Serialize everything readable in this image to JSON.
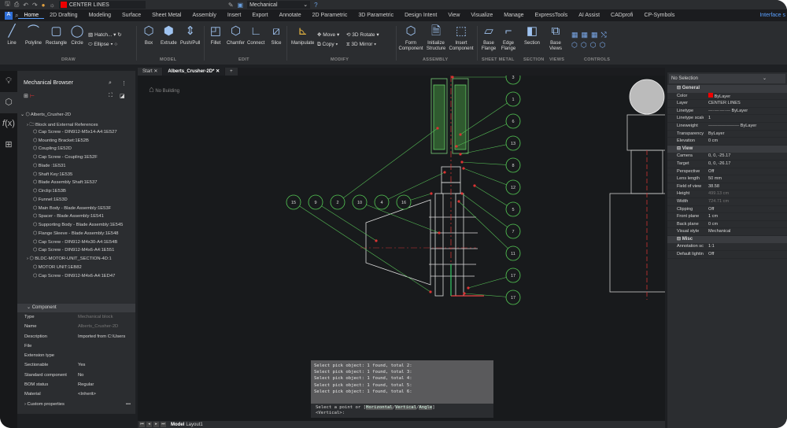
{
  "quick_access": {
    "layer": "CENTER LINES",
    "layer_color": "#e00000",
    "workspace": "Mechanical"
  },
  "menu": {
    "tabs": [
      "Home",
      "2D Drafting",
      "Modeling",
      "Surface",
      "Sheet Metal",
      "Assembly",
      "Insert",
      "Export",
      "Annotate",
      "2D Parametric",
      "3D Parametric",
      "Design Intent",
      "View",
      "Visualize",
      "Manage",
      "ExpressTools",
      "AI Assist",
      "CADprofi",
      "CP-Symbols"
    ],
    "interface": "Interface s"
  },
  "ribbon": {
    "draw": {
      "label": "DRAW",
      "buttons": [
        "Line",
        "Polyline",
        "Rectangle",
        "Circle"
      ],
      "small": [
        "Hatch...",
        "Ellipse"
      ]
    },
    "model": {
      "label": "MODEL",
      "buttons": [
        "Box",
        "Extrude",
        "Push/Pull"
      ]
    },
    "edit": {
      "label": "EDIT",
      "buttons": [
        "Fillet",
        "Chamfer",
        "Connect",
        "Slice"
      ]
    },
    "modify": {
      "label": "MODIFY",
      "buttons": [
        "Manipulate"
      ],
      "small": [
        "Move",
        "Copy",
        "3D Rotate",
        "3D Mirror"
      ]
    },
    "assembly": {
      "label": "ASSEMBLY",
      "buttons": [
        "Form Component",
        "Initialize Structure",
        "Insert Component"
      ]
    },
    "sheet_metal": {
      "label": "SHEET METAL",
      "buttons": [
        "Base Flange",
        "Edge Flange"
      ]
    },
    "section": {
      "label": "SECTION",
      "buttons": [
        "Section"
      ]
    },
    "views": {
      "label": "VIEWS",
      "buttons": [
        "Base Views"
      ]
    },
    "controls": {
      "label": "CONTROLS"
    }
  },
  "browser": {
    "title": "Mechanical Browser",
    "root": "Alberts_Crusher-2D",
    "items": [
      "Block and External References",
      "Cap Screw - DIN912-M5x14-A4:1E527",
      "Mounting Bracket:1E52B",
      "Coupling:1E52D",
      "Cap Screw - Coupling:1E52F",
      "Blade :1E531",
      "Shaft Key:1E535",
      "Blade Assembly Shaft:1E537",
      "Circlip:1E53B",
      "Funnel:1E53D",
      "Main Body - Blade Assembly:1E53F",
      "Spacer - Blade Assembly:1E541",
      "Supporting Body - Blade Assembly:1E545",
      "Flange Sleeve - Blade Assembly:1E548",
      "Cap Screw - DIN912-M4x30-A4:1E54B",
      "Cap Screw - DIN912-M4x6-A4:1E551",
      "BLDC-MOTOR-UNIT_SECTION-4D:1",
      "MOTOR UNIT:1EB82",
      "Cap Screw - DIN912-M4x6-A4:1ED47"
    ]
  },
  "component": {
    "header": "Component",
    "rows": [
      [
        "Type",
        "Mechanical block"
      ],
      [
        "Name",
        "Alberts_Crusher-2D"
      ],
      [
        "Description",
        "Imported from C:\\Users"
      ],
      [
        "File",
        ""
      ],
      [
        "Extension type",
        ""
      ],
      [
        "Sectionable",
        "Yes"
      ],
      [
        "Standard component",
        "No"
      ],
      [
        "BOM status",
        "Regular"
      ],
      [
        "Material",
        "<Inherit>"
      ]
    ],
    "custom": "Custom properties"
  },
  "doc_tabs": [
    "Start",
    "Alberts_Crusher-2D*"
  ],
  "canvas": {
    "building": "No Building",
    "balloons_left": [
      "15",
      "9",
      "2",
      "10",
      "4",
      "16"
    ],
    "balloons_right": [
      "3",
      "1",
      "6",
      "13",
      "8",
      "12",
      "5",
      "7",
      "11",
      "17",
      "17"
    ]
  },
  "command": {
    "history": [
      "Select pick object: 1 found, total 2:",
      "Select pick object: 1 found, total 3:",
      "Select pick object: 1 found, total 4:",
      "Select pick object: 1 found, total 5:",
      "Select pick object: 1 found, total 6:"
    ],
    "prompt_pre": "Select a point or [",
    "opt1": "Horizontal",
    "opt2": "Vertical",
    "opt3": "Angle",
    "prompt_post": "]",
    "default": "<Vertical>:"
  },
  "layout_tabs": [
    "Model",
    "Layout1"
  ],
  "properties": {
    "selection": "No Selection",
    "general": {
      "header": "General",
      "rows": [
        [
          "Color",
          "ByLayer"
        ],
        [
          "Layer",
          "CENTER LINES"
        ],
        [
          "Linetype",
          "ByLayer"
        ],
        [
          "Linetype scale",
          "1"
        ],
        [
          "Lineweight",
          "ByLayer"
        ],
        [
          "Transparency",
          "ByLayer"
        ],
        [
          "Elevation",
          "0 cm"
        ]
      ]
    },
    "view": {
      "header": "View",
      "rows": [
        [
          "Camera",
          "0, 0, -25.17"
        ],
        [
          "Target",
          "0, 0, -26.17"
        ],
        [
          "Perspective",
          "Off"
        ],
        [
          "Lens length",
          "50 mm"
        ],
        [
          "Field of view",
          "38.58"
        ],
        [
          "Height",
          "499.13 cm"
        ],
        [
          "Width",
          "724.71 cm"
        ],
        [
          "Clipping",
          "Off"
        ],
        [
          "Front plane",
          "1 cm"
        ],
        [
          "Back plane",
          "0 cm"
        ],
        [
          "Visual style",
          "Mechanical"
        ]
      ]
    },
    "misc": {
      "header": "Misc",
      "rows": [
        [
          "Annotation scale",
          "1:1"
        ],
        [
          "Default lighting",
          "Off"
        ]
      ]
    }
  }
}
